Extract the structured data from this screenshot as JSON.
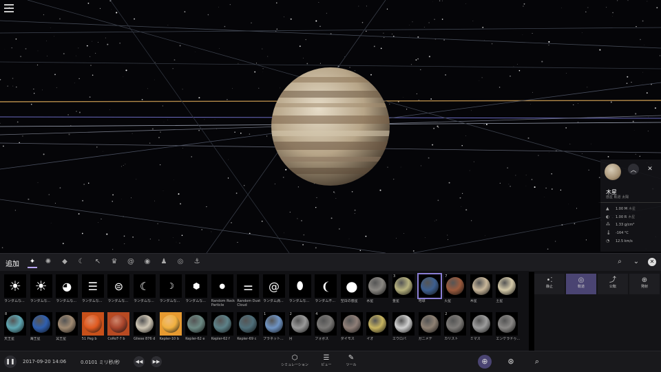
{
  "info_card": {
    "name": "木星",
    "subtitle": "惑星 軌道 太陽",
    "stats": [
      {
        "icon": "mass-icon",
        "value": "1.00 M",
        "unit": "木星"
      },
      {
        "icon": "radius-icon",
        "value": "1.00 R",
        "unit": "木星"
      },
      {
        "icon": "density-icon",
        "value": "1.33 g/cm³",
        "unit": ""
      },
      {
        "icon": "temperature-icon",
        "value": "-164 °C",
        "unit": ""
      },
      {
        "icon": "velocity-icon",
        "value": "12.5 km/s",
        "unit": ""
      }
    ]
  },
  "toolbar": {
    "title": "追加",
    "categories": [
      "sparkle-icon",
      "star-icon",
      "bird-icon",
      "moon-icon",
      "wand-icon",
      "ship-icon",
      "galaxy-icon",
      "eye-icon",
      "people-icon",
      "target-icon",
      "anchor-icon"
    ]
  },
  "tiles_row1": [
    {
      "label": "ランダムな...",
      "kind": "sun"
    },
    {
      "label": "ランダムな...",
      "kind": "sun"
    },
    {
      "label": "ランダムな...",
      "kind": "globe"
    },
    {
      "label": "ランダムな...",
      "kind": "bands"
    },
    {
      "label": "ランダムな...",
      "kind": "bands2"
    },
    {
      "label": "ランダムな...",
      "kind": "moon"
    },
    {
      "label": "ランダムな...",
      "kind": "moon-small"
    },
    {
      "label": "ランダムな...",
      "kind": "hex"
    },
    {
      "label": "Random Rock Particle",
      "kind": "dot"
    },
    {
      "label": "Random Dust Cloud",
      "kind": "dash"
    },
    {
      "label": "ランダム渦...",
      "kind": "spiral"
    },
    {
      "label": "ランダムな...",
      "kind": "blob"
    },
    {
      "label": "ランダム不...",
      "kind": "bean"
    },
    {
      "label": "空白の惑星",
      "kind": "circle"
    },
    {
      "label": "水星",
      "kind": "planet",
      "color": "#8a8782"
    },
    {
      "label": "金星",
      "kind": "planet",
      "color": "#b7b27e"
    },
    {
      "label": "地球",
      "kind": "planet",
      "color": "#3d5f8f",
      "selected": true
    },
    {
      "label": "火星",
      "kind": "planet",
      "color": "#9a5a3d"
    },
    {
      "label": "木星",
      "kind": "planet",
      "color": "#c9b79a"
    },
    {
      "label": "土星",
      "kind": "planet",
      "color": "#d4c9a8"
    }
  ],
  "tiles_row2": [
    {
      "label": "天王星",
      "kind": "planet",
      "color": "#5fa7b3"
    },
    {
      "label": "海王星",
      "kind": "planet",
      "color": "#2f5fb0"
    },
    {
      "label": "冥王星",
      "kind": "planet",
      "color": "#a08a72"
    },
    {
      "label": "51 Peg b",
      "kind": "planet",
      "color": "#e05a20",
      "bg": "#c8501a"
    },
    {
      "label": "CoRoT-7 b",
      "kind": "planet",
      "color": "#a9452c",
      "bg": "#b84a22"
    },
    {
      "label": "Gliese 876 d",
      "kind": "planet",
      "color": "#cfc6b4"
    },
    {
      "label": "Kepler-10 b",
      "kind": "planet",
      "color": "#f0b040",
      "bg": "#e79a30"
    },
    {
      "label": "Kepler-62 e",
      "kind": "planet",
      "color": "#6d8a84"
    },
    {
      "label": "Kepler-62 f",
      "kind": "planet",
      "color": "#5d8289"
    },
    {
      "label": "Kepler-69 c",
      "kind": "planet",
      "color": "#4f6f7a"
    },
    {
      "label": "プラネット...",
      "kind": "planet",
      "color": "#6f94c4"
    },
    {
      "label": "月",
      "kind": "planet",
      "color": "#9a9a9a"
    },
    {
      "label": "フォボス",
      "kind": "planet",
      "color": "#7a7876"
    },
    {
      "label": "ダイモス",
      "kind": "planet",
      "color": "#8f7f78"
    },
    {
      "label": "イオ",
      "kind": "planet",
      "color": "#c7b460"
    },
    {
      "label": "エウロパ",
      "kind": "planet",
      "color": "#cfcfcf"
    },
    {
      "label": "ガニメデ",
      "kind": "planet",
      "color": "#8e8173"
    },
    {
      "label": "カリスト",
      "kind": "planet",
      "color": "#7e7b78"
    },
    {
      "label": "ミマス",
      "kind": "planet",
      "color": "#9c9c9c"
    },
    {
      "label": "エンケラドゥ...",
      "kind": "planet",
      "color": "#8a8886"
    }
  ],
  "badges": {
    "row1_16": "3",
    "row1_18": "7",
    "row2_1": "8",
    "row2_11": "1",
    "row2_12": "2",
    "row2_13": "4",
    "row2_18": "2"
  },
  "modes": [
    {
      "label": "静止",
      "icon": "static-icon"
    },
    {
      "label": "軌道",
      "icon": "orbit-icon",
      "active": true
    },
    {
      "label": "公転",
      "icon": "revolve-icon"
    },
    {
      "label": "発射",
      "icon": "launch-icon"
    }
  ],
  "bottom": {
    "datetime": "2017-09-20 14:06",
    "speed": "0.0101  ミリ秒/秒",
    "tabs": [
      "シミュレーション",
      "ビュー",
      "ツール"
    ]
  },
  "colors": {
    "accent": "#4a4472",
    "selected_outline": "#8b7fd6"
  }
}
